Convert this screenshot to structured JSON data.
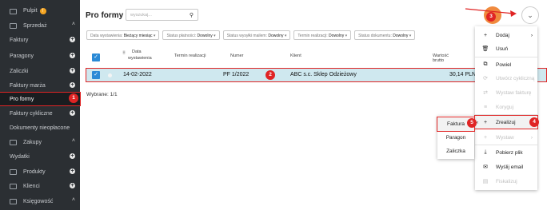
{
  "sidebar": {
    "items": [
      {
        "label": "Pulpit",
        "badge": "!",
        "kind": "head"
      },
      {
        "label": "Sprzedaż",
        "kind": "section"
      },
      {
        "label": "Faktury",
        "kind": "sub"
      },
      {
        "label": "Paragony",
        "kind": "sub"
      },
      {
        "label": "Zaliczki",
        "kind": "sub"
      },
      {
        "label": "Faktury marża",
        "kind": "sub"
      },
      {
        "label": "Pro formy",
        "kind": "active"
      },
      {
        "label": "Faktury cykliczne",
        "kind": "sub"
      },
      {
        "label": "Dokumenty nieopłacone",
        "kind": "plain"
      },
      {
        "label": "Zakupy",
        "kind": "section"
      },
      {
        "label": "Wydatki",
        "kind": "sub"
      },
      {
        "label": "Produkty",
        "kind": "section2"
      },
      {
        "label": "Klienci",
        "kind": "section2"
      },
      {
        "label": "Księgowość",
        "kind": "section"
      }
    ]
  },
  "header": {
    "title": "Pro formy",
    "search_placeholder": "wyszukaj..."
  },
  "filters": [
    {
      "label": "Data wystawienia",
      "value": "Bieżący miesiąc"
    },
    {
      "label": "Status płatności",
      "value": "Dowolny"
    },
    {
      "label": "Status wysyłki mailem",
      "value": "Dowolny"
    },
    {
      "label": "Termin realizacji",
      "value": "Dowolny"
    },
    {
      "label": "Status dokumentu",
      "value": "Dowolny"
    }
  ],
  "table": {
    "headers": {
      "date": "Data",
      "date2": "wystawienia",
      "term": "Termin realizacji",
      "number": "Numer",
      "client": "Klient",
      "value": "Wartość brutto"
    },
    "row": {
      "date": "14-02-2022",
      "number": "PF 1/2022",
      "client": "ABC s.c. Sklep Odzieżowy",
      "value": "30,14 PLN"
    }
  },
  "selected_text": "Wybrane: 1/1",
  "menu": [
    {
      "label": "Dodaj",
      "icon": "+",
      "enabled": true,
      "arrow": "›"
    },
    {
      "label": "Usuń",
      "icon": "🗑",
      "enabled": true
    },
    {
      "label": "Powiel",
      "icon": "⧉",
      "enabled": true
    },
    {
      "label": "Utwórz cykliczną",
      "icon": "⟳",
      "enabled": false
    },
    {
      "label": "Wystaw fakturę",
      "icon": "⇄",
      "enabled": false
    },
    {
      "label": "Koryguj",
      "icon": "≡",
      "enabled": false
    },
    {
      "label": "Zrealizuj",
      "icon": "+",
      "enabled": true,
      "arrow": "‹"
    },
    {
      "label": "Wystaw",
      "icon": "+",
      "enabled": false,
      "arrow": "›"
    },
    {
      "label": "Pobierz plik",
      "icon": "⤓",
      "enabled": true
    },
    {
      "label": "Wyślij email",
      "icon": "✉",
      "enabled": true
    },
    {
      "label": "Fiskalizuj",
      "icon": "▤",
      "enabled": false
    }
  ],
  "submenu": [
    {
      "label": "Faktura"
    },
    {
      "label": "Paragon"
    },
    {
      "label": "Zaliczka"
    }
  ],
  "steps": [
    "1",
    "2",
    "3",
    "4",
    "5"
  ],
  "colors": {
    "accent": "#2a8ad6",
    "annotation": "#e02424",
    "sidebar": "#2b2f33",
    "orange_button": "#f08a3e"
  }
}
